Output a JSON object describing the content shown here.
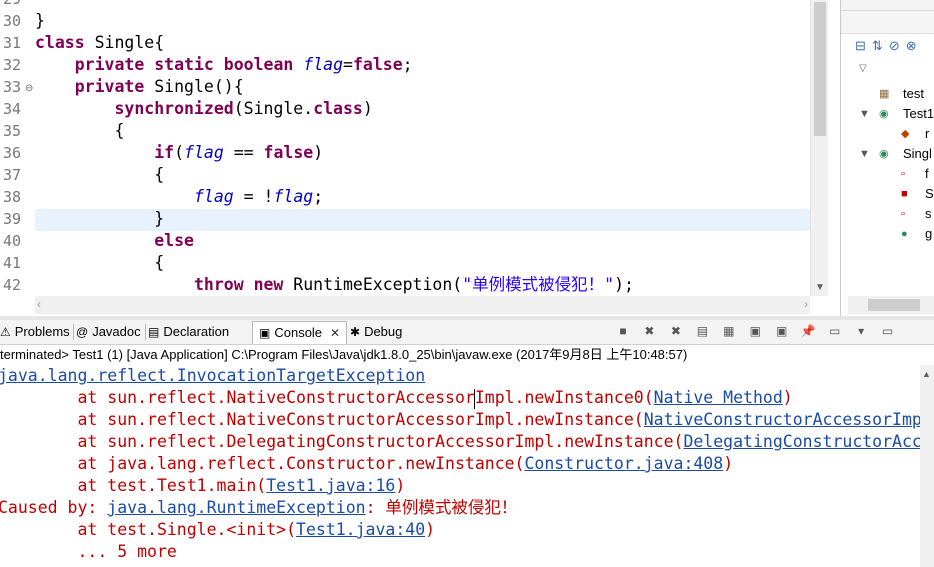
{
  "editor": {
    "lines": [
      {
        "num": "29",
        "segments": []
      },
      {
        "num": "30",
        "segments": [
          {
            "t": "}",
            "c": ""
          }
        ]
      },
      {
        "num": "31",
        "segments": [
          {
            "t": "class",
            "c": "kw"
          },
          {
            "t": " Single{",
            "c": ""
          }
        ]
      },
      {
        "num": "32",
        "segments": [
          {
            "t": "    ",
            "c": ""
          },
          {
            "t": "private",
            "c": "kw"
          },
          {
            "t": " ",
            "c": ""
          },
          {
            "t": "static",
            "c": "kw"
          },
          {
            "t": " ",
            "c": ""
          },
          {
            "t": "boolean",
            "c": "kw"
          },
          {
            "t": " ",
            "c": ""
          },
          {
            "t": "flag",
            "c": "fld"
          },
          {
            "t": "=",
            "c": ""
          },
          {
            "t": "false",
            "c": "kw"
          },
          {
            "t": ";",
            "c": ""
          }
        ]
      },
      {
        "num": "33",
        "segments": [
          {
            "t": "    ",
            "c": ""
          },
          {
            "t": "private",
            "c": "kw"
          },
          {
            "t": " Single(){",
            "c": ""
          }
        ]
      },
      {
        "num": "34",
        "segments": [
          {
            "t": "        ",
            "c": ""
          },
          {
            "t": "synchronized",
            "c": "kw"
          },
          {
            "t": "(Single.",
            "c": ""
          },
          {
            "t": "class",
            "c": "kw"
          },
          {
            "t": ")",
            "c": ""
          }
        ]
      },
      {
        "num": "35",
        "segments": [
          {
            "t": "        {",
            "c": ""
          }
        ]
      },
      {
        "num": "36",
        "segments": [
          {
            "t": "            ",
            "c": ""
          },
          {
            "t": "if",
            "c": "kw"
          },
          {
            "t": "(",
            "c": ""
          },
          {
            "t": "flag",
            "c": "fld"
          },
          {
            "t": " == ",
            "c": ""
          },
          {
            "t": "false",
            "c": "kw"
          },
          {
            "t": ")",
            "c": ""
          }
        ]
      },
      {
        "num": "37",
        "segments": [
          {
            "t": "            {",
            "c": ""
          }
        ]
      },
      {
        "num": "38",
        "segments": [
          {
            "t": "                ",
            "c": ""
          },
          {
            "t": "flag",
            "c": "fld"
          },
          {
            "t": " = !",
            "c": ""
          },
          {
            "t": "flag",
            "c": "fld"
          },
          {
            "t": ";",
            "c": ""
          }
        ]
      },
      {
        "num": "39",
        "segments": [
          {
            "t": "            }",
            "c": ""
          }
        ]
      },
      {
        "num": "40",
        "segments": [
          {
            "t": "            ",
            "c": ""
          },
          {
            "t": "else",
            "c": "kw"
          }
        ]
      },
      {
        "num": "41",
        "segments": [
          {
            "t": "            {",
            "c": ""
          }
        ]
      },
      {
        "num": "42",
        "segments": [
          {
            "t": "                ",
            "c": ""
          },
          {
            "t": "throw",
            "c": "kw"
          },
          {
            "t": " ",
            "c": ""
          },
          {
            "t": "new",
            "c": "kw"
          },
          {
            "t": " RuntimeException(",
            "c": ""
          },
          {
            "t": "\"单例模式被侵犯！\"",
            "c": "str"
          },
          {
            "t": ");",
            "c": ""
          }
        ]
      }
    ]
  },
  "outline": {
    "items": [
      {
        "label": "test",
        "icon": "package-icon",
        "color": "#8a6d3b",
        "expander": ""
      },
      {
        "label": "Test1",
        "icon": "class-run-icon",
        "color": "#2e8b57",
        "expander": "▼"
      },
      {
        "label": "r",
        "icon": "static-method-icon",
        "color": "#c04000",
        "expander": ""
      },
      {
        "label": "Singl",
        "icon": "class-icon",
        "color": "#2e8b57",
        "expander": "▼"
      },
      {
        "label": "f",
        "icon": "private-field-icon",
        "color": "#c00000",
        "expander": ""
      },
      {
        "label": "S",
        "icon": "private-constructor-icon",
        "color": "#c00000",
        "expander": ""
      },
      {
        "label": "s",
        "icon": "static-field-icon",
        "color": "#c00000",
        "expander": ""
      },
      {
        "label": "g",
        "icon": "public-method-icon",
        "color": "#2e8b57",
        "expander": ""
      }
    ]
  },
  "tabs": [
    {
      "label": "Problems",
      "icon": "problems-icon",
      "active": false
    },
    {
      "label": "Javadoc",
      "icon": "javadoc-icon",
      "active": false
    },
    {
      "label": "Declaration",
      "icon": "declaration-icon",
      "active": false
    },
    {
      "label": "Console",
      "icon": "console-icon",
      "active": true,
      "close": "✕"
    },
    {
      "label": "Debug",
      "icon": "debug-icon",
      "active": false
    }
  ],
  "console": {
    "header": "terminated> Test1 (1) [Java Application] C:\\Program Files\\Java\\jdk1.8.0_25\\bin\\javaw.exe (2017年9月8日 上午10:48:57)",
    "lines": [
      {
        "segments": [
          {
            "t": "java.lang.reflect.InvocationTargetException",
            "link": true
          }
        ]
      },
      {
        "segments": [
          {
            "t": "        at sun.reflect.NativeConstructorAccessorImpl.newInstance0(",
            "link": false
          },
          {
            "t": "Native Method",
            "link": true
          },
          {
            "t": ")",
            "link": false
          }
        ]
      },
      {
        "segments": [
          {
            "t": "        at sun.reflect.NativeConstructorAccessorImpl.newInstance(",
            "link": false
          },
          {
            "t": "NativeConstructorAccessorImp",
            "link": true
          }
        ]
      },
      {
        "segments": [
          {
            "t": "        at sun.reflect.DelegatingConstructorAccessorImpl.newInstance(",
            "link": false
          },
          {
            "t": "DelegatingConstructorAcc",
            "link": true
          }
        ]
      },
      {
        "segments": [
          {
            "t": "        at java.lang.reflect.Constructor.newInstance(",
            "link": false
          },
          {
            "t": "Constructor.java:408",
            "link": true
          },
          {
            "t": ")",
            "link": false
          }
        ]
      },
      {
        "segments": [
          {
            "t": "        at test.Test1.main(",
            "link": false
          },
          {
            "t": "Test1.java:16",
            "link": true
          },
          {
            "t": ")",
            "link": false
          }
        ]
      },
      {
        "segments": [
          {
            "t": "Caused by: ",
            "link": false
          },
          {
            "t": "java.lang.RuntimeException",
            "link": true
          },
          {
            "t": ": 单例模式被侵犯！",
            "link": false
          }
        ]
      },
      {
        "segments": [
          {
            "t": "        at test.Single.<init>(",
            "link": false
          },
          {
            "t": "Test1.java:40",
            "link": true
          },
          {
            "t": ")",
            "link": false
          }
        ]
      },
      {
        "segments": [
          {
            "t": "        ... 5 more",
            "link": false
          }
        ]
      }
    ]
  }
}
